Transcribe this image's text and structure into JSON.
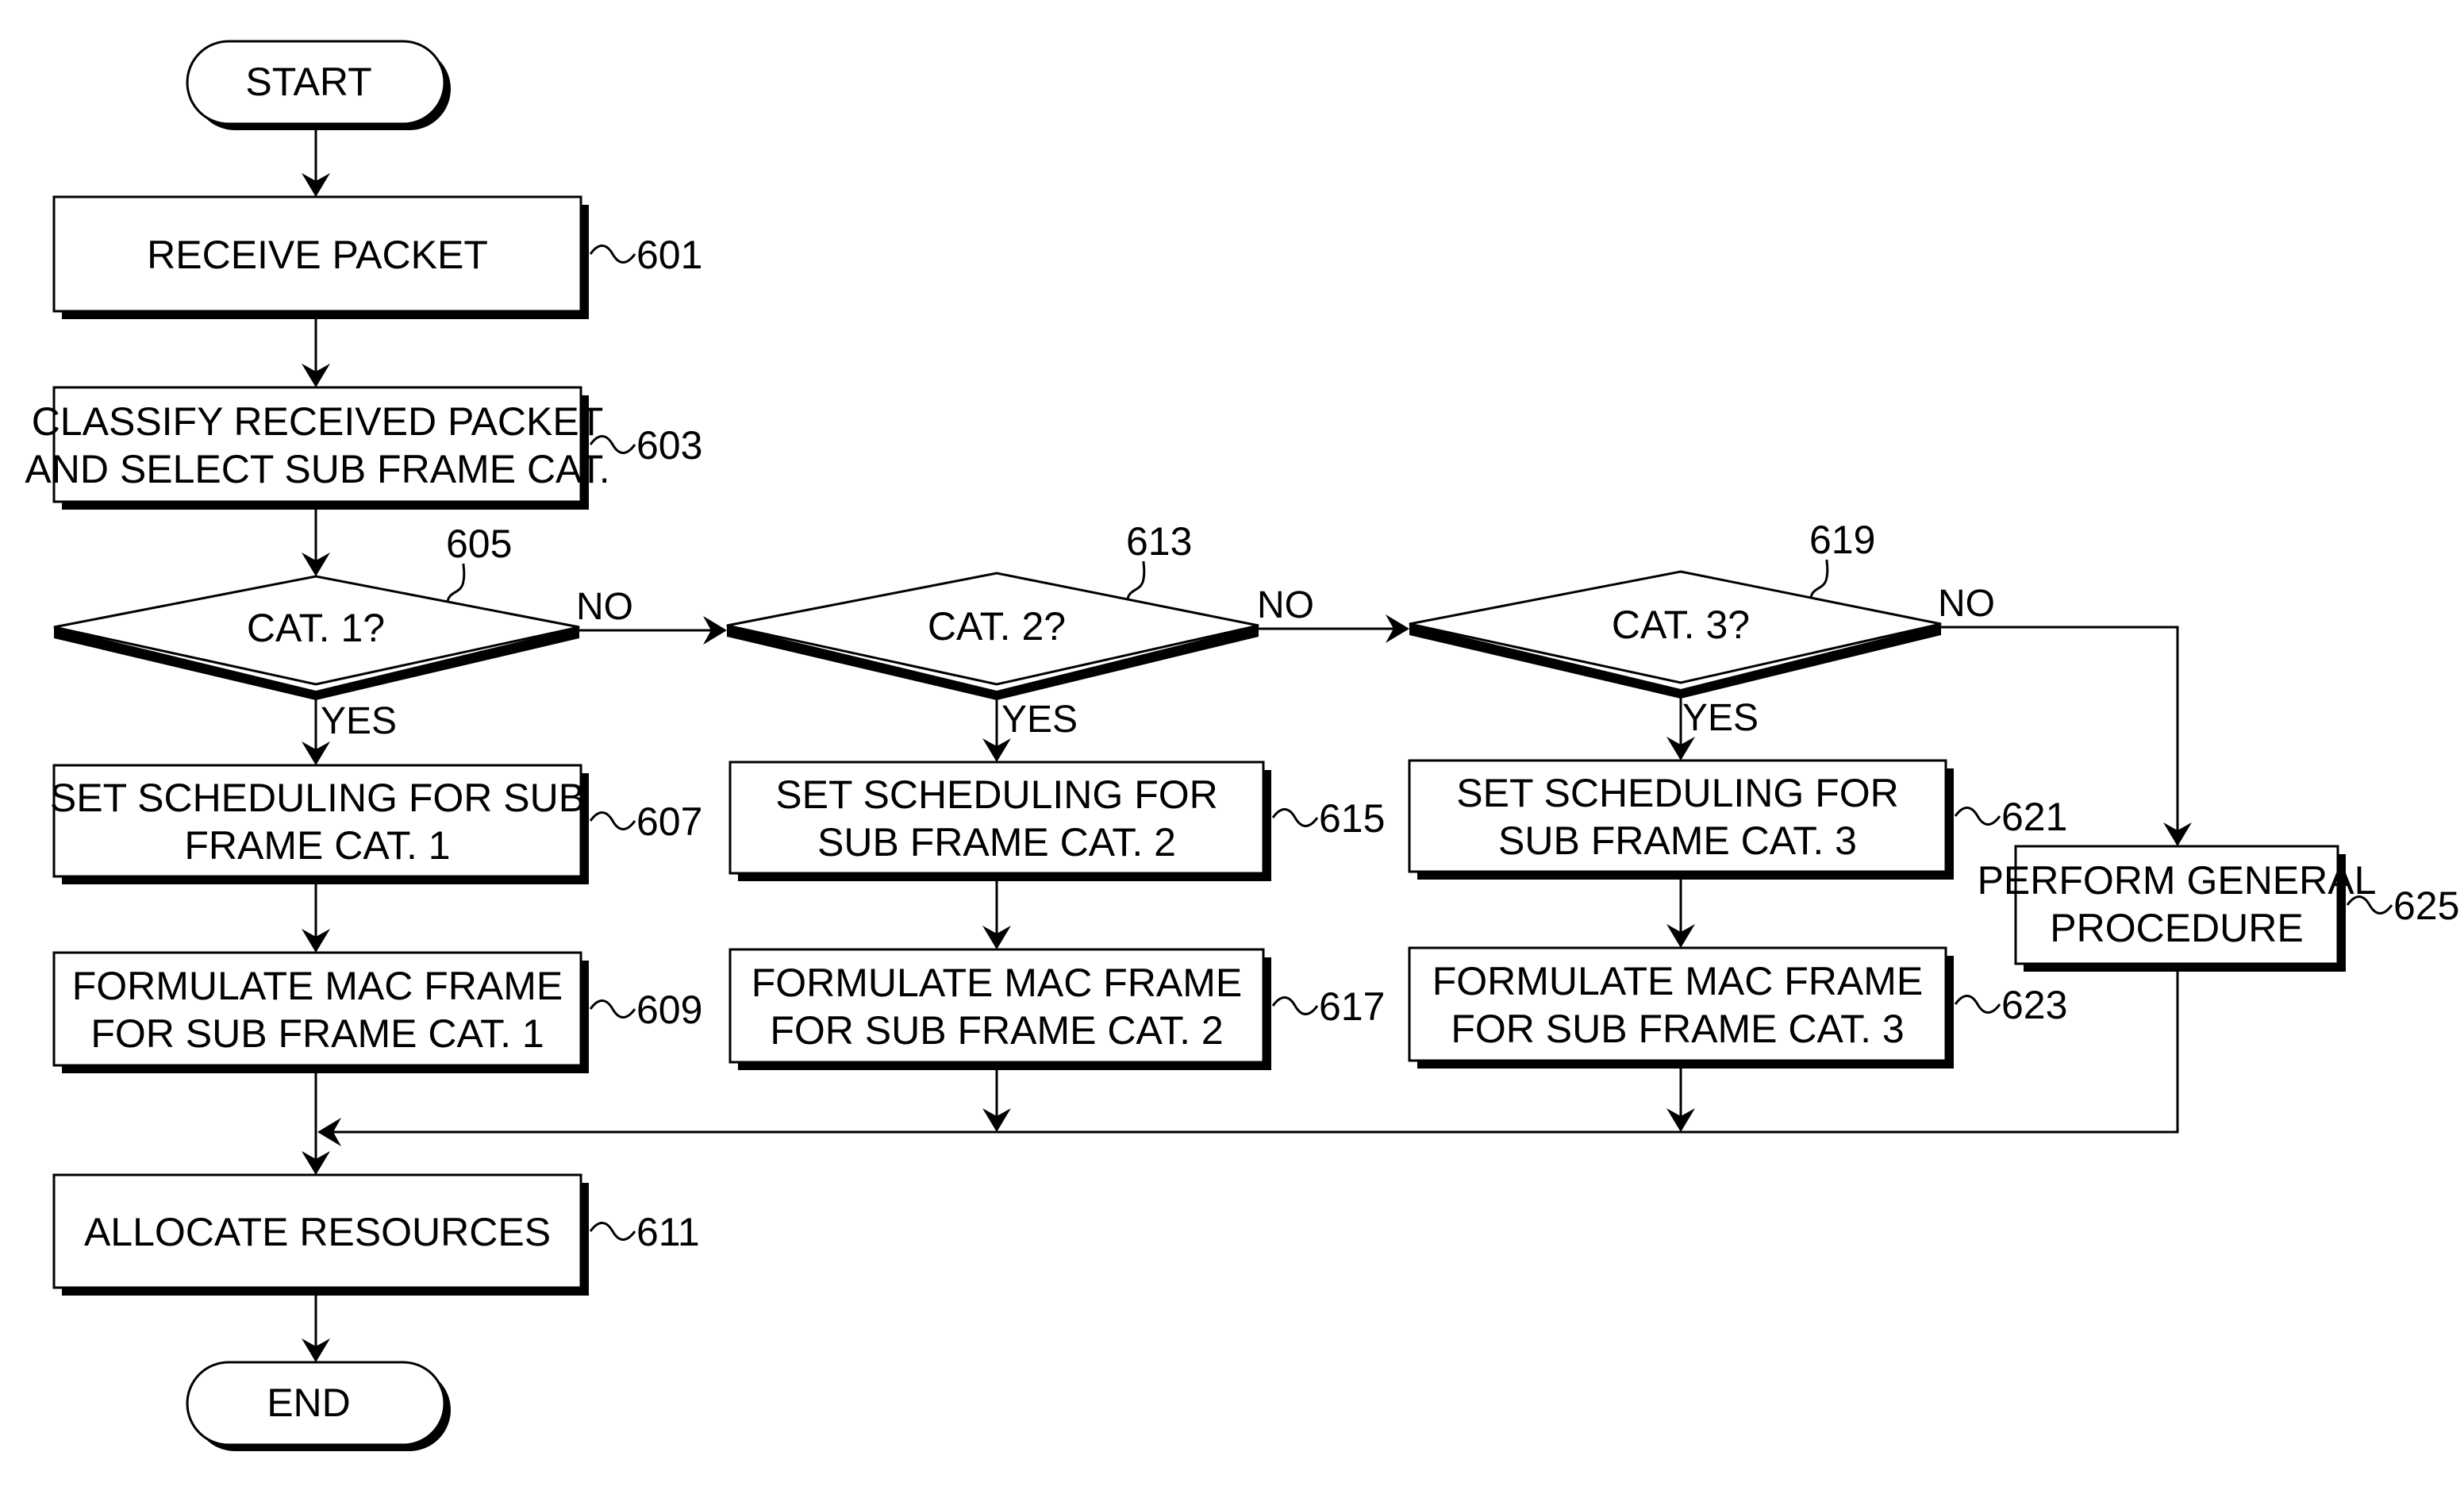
{
  "diagram": {
    "terminals": {
      "start": "START",
      "end": "END"
    },
    "steps": {
      "s601": {
        "ref": "601",
        "lines": [
          "RECEIVE PACKET"
        ]
      },
      "s603": {
        "ref": "603",
        "lines": [
          "CLASSIFY RECEIVED PACKET",
          "AND SELECT SUB FRAME CAT."
        ]
      },
      "s607": {
        "ref": "607",
        "lines": [
          "SET SCHEDULING FOR SUB",
          "FRAME CAT. 1"
        ]
      },
      "s609": {
        "ref": "609",
        "lines": [
          "FORMULATE MAC FRAME",
          "FOR SUB FRAME CAT. 1"
        ]
      },
      "s611": {
        "ref": "611",
        "lines": [
          "ALLOCATE RESOURCES"
        ]
      },
      "s615": {
        "ref": "615",
        "lines": [
          "SET SCHEDULING FOR",
          "SUB FRAME CAT. 2"
        ]
      },
      "s617": {
        "ref": "617",
        "lines": [
          "FORMULATE MAC FRAME",
          "FOR SUB FRAME CAT. 2"
        ]
      },
      "s621": {
        "ref": "621",
        "lines": [
          "SET SCHEDULING FOR",
          "SUB FRAME CAT. 3"
        ]
      },
      "s623": {
        "ref": "623",
        "lines": [
          "FORMULATE MAC FRAME",
          "FOR SUB FRAME CAT. 3"
        ]
      },
      "s625": {
        "ref": "625",
        "lines": [
          "PERFORM GENERAL",
          "PROCEDURE"
        ]
      }
    },
    "decisions": {
      "d605": {
        "ref": "605",
        "label": "CAT. 1?"
      },
      "d613": {
        "ref": "613",
        "label": "CAT. 2?"
      },
      "d619": {
        "ref": "619",
        "label": "CAT. 3?"
      }
    },
    "branch_labels": {
      "yes": "YES",
      "no": "NO"
    }
  }
}
